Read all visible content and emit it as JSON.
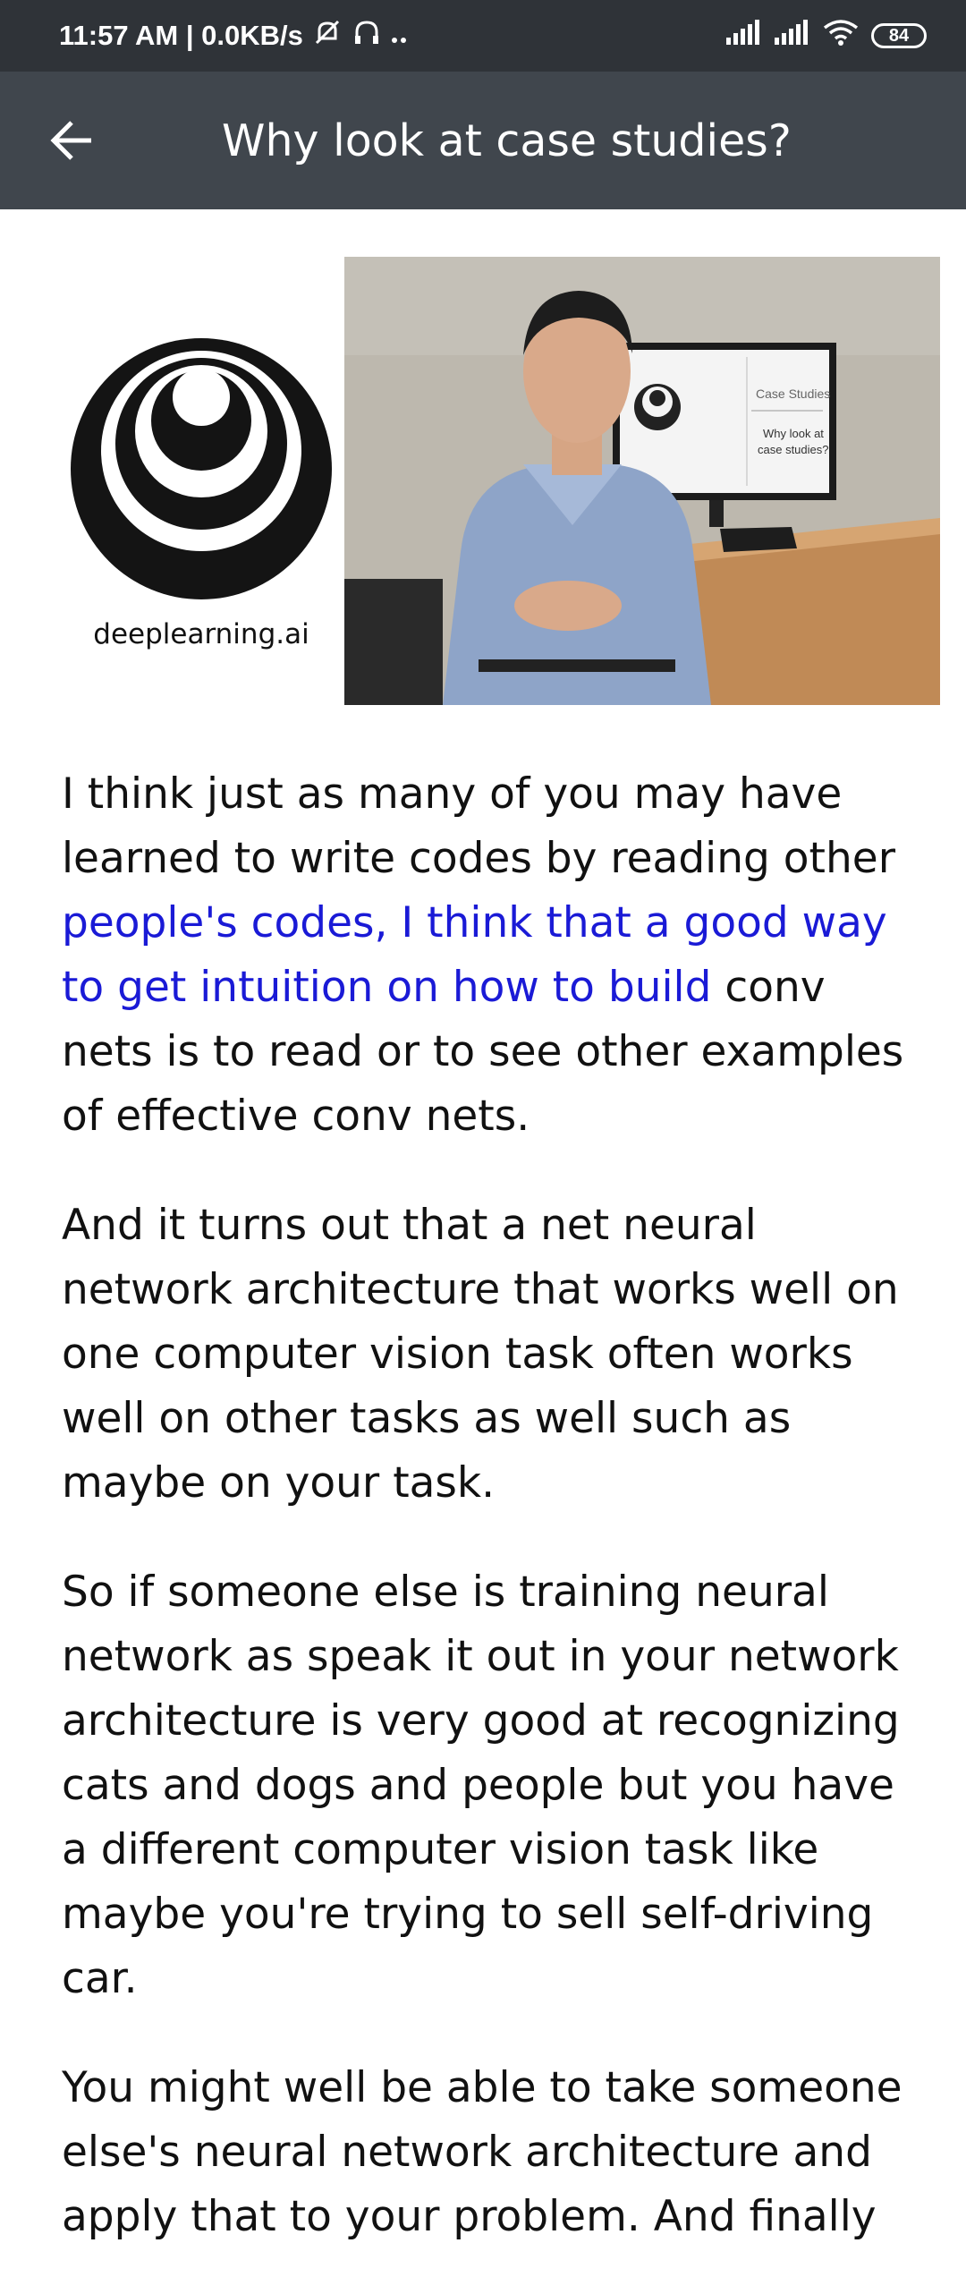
{
  "status_bar": {
    "time_speed": "11:57 AM | 0.0KB/s",
    "battery": "84"
  },
  "header": {
    "title": "Why look at case studies?"
  },
  "video": {
    "logo_caption": "deeplearning.ai",
    "screen_title": "Case Studies",
    "screen_subtitle_line1": "Why look at",
    "screen_subtitle_line2": "case studies?"
  },
  "transcript": {
    "p1_before": "I think just as many of you may have learned to write codes by reading other ",
    "p1_highlight": "people's codes, I think that a good way to get intuition on how to build",
    "p1_after": " conv nets is to read or to see other examples of effective conv nets.",
    "p2": "And it turns out that a net neural network architecture that works well on one com­puter vision task often works well on other tasks as well such as maybe on your task.",
    "p3": "So if someone else is training neural network as speak it out in your network architecture is very good at recognizing cats and dogs and people but you have a different computer vision task like maybe you're trying to sell self-driving car.",
    "p4": "You might well be able to take someone else's neural network architecture and apply that to your problem. And finally"
  }
}
